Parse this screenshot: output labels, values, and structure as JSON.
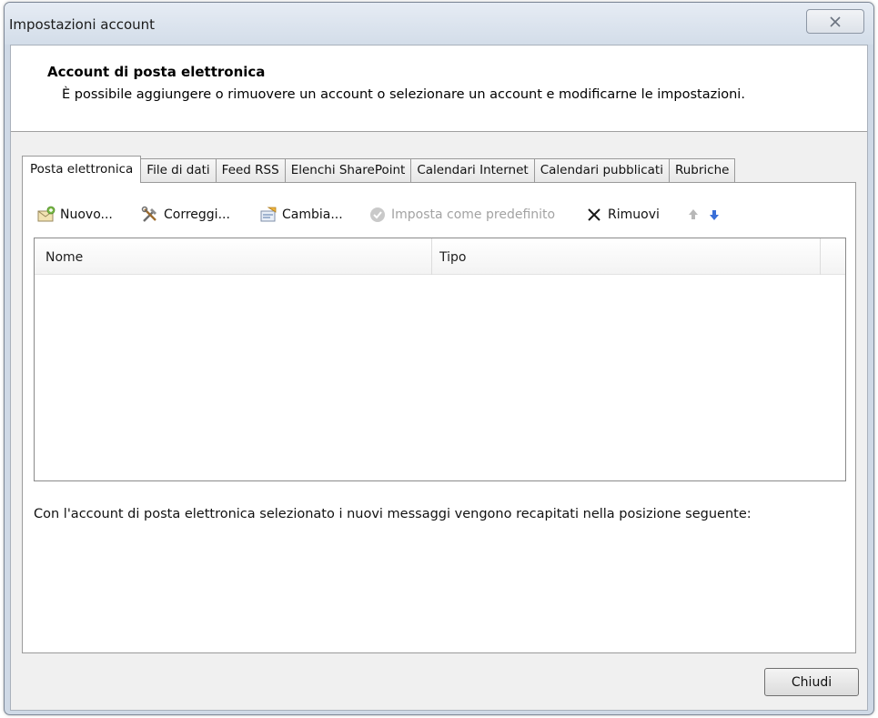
{
  "window": {
    "title": "Impostazioni account"
  },
  "header": {
    "title": "Account di posta elettronica",
    "subtitle": "È possibile aggiungere o rimuovere un account o selezionare un account e modificarne le impostazioni."
  },
  "tabs": [
    {
      "label": "Posta elettronica",
      "active": true
    },
    {
      "label": "File di dati",
      "active": false
    },
    {
      "label": "Feed RSS",
      "active": false
    },
    {
      "label": "Elenchi SharePoint",
      "active": false
    },
    {
      "label": "Calendari Internet",
      "active": false
    },
    {
      "label": "Calendari pubblicati",
      "active": false
    },
    {
      "label": "Rubriche",
      "active": false
    }
  ],
  "toolbar": {
    "new_label": "Nuovo...",
    "repair_label": "Correggi...",
    "change_label": "Cambia...",
    "default_label": "Imposta come predefinito",
    "remove_label": "Rimuovi",
    "new_icon": "new-email-account-icon",
    "repair_icon": "repair-tools-icon",
    "change_icon": "change-settings-icon",
    "default_icon": "checkmark-icon",
    "remove_icon": "remove-x-icon",
    "up_icon": "move-up-arrow-icon",
    "down_icon": "move-down-arrow-icon"
  },
  "account_list": {
    "columns": [
      "Nome",
      "Tipo"
    ],
    "rows": []
  },
  "info_text": "Con l'account di posta elettronica selezionato i nuovi messaggi vengono recapitati nella posizione seguente:",
  "footer": {
    "close_label": "Chiudi"
  },
  "colors": {
    "window_frame": "#cfd9e6",
    "client_bg": "#f0f0f0",
    "disabled_text": "#a3a3a3",
    "arrow_down": "#3a6fd8",
    "arrow_up_disabled": "#b8b8b8"
  }
}
